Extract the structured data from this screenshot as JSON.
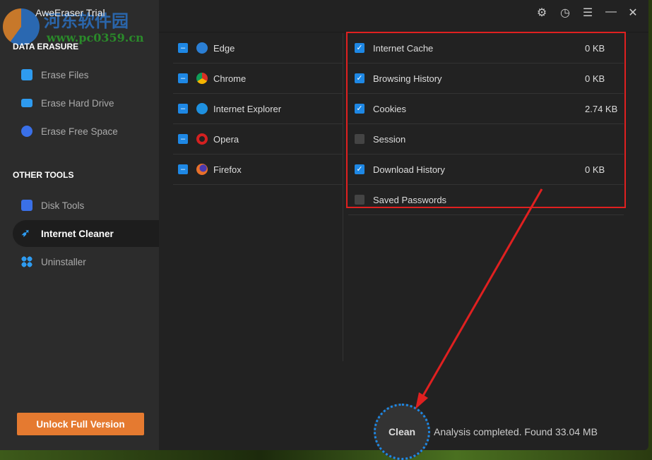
{
  "window": {
    "title": "AweEraser Trial"
  },
  "watermark": {
    "text": "河东软件园",
    "url": "www.pc0359.cn"
  },
  "sidebar": {
    "sections": [
      {
        "title": "DATA ERASURE"
      },
      {
        "title": "OTHER TOOLS"
      }
    ],
    "items": [
      {
        "label": "Erase Files",
        "icon": "folder-icon"
      },
      {
        "label": "Erase Hard Drive",
        "icon": "hard-drive-icon"
      },
      {
        "label": "Erase Free Space",
        "icon": "pie-chart-icon"
      },
      {
        "label": "Disk Tools",
        "icon": "toolbox-icon"
      },
      {
        "label": "Internet Cleaner",
        "icon": "rocket-icon",
        "active": true
      },
      {
        "label": "Uninstaller",
        "icon": "apps-icon"
      }
    ],
    "unlock_label": "Unlock Full Version"
  },
  "browsers": [
    {
      "name": "Edge",
      "color": "#2b7fd4"
    },
    {
      "name": "Chrome",
      "color": "#e8b020"
    },
    {
      "name": "Internet Explorer",
      "color": "#1e90e0"
    },
    {
      "name": "Opera",
      "color": "#d42020"
    },
    {
      "name": "Firefox",
      "color": "#e8702a"
    }
  ],
  "categories": [
    {
      "label": "Internet Cache",
      "checked": true,
      "size": "0 KB"
    },
    {
      "label": "Browsing History",
      "checked": true,
      "size": "0 KB"
    },
    {
      "label": "Cookies",
      "checked": true,
      "size": "2.74 KB"
    },
    {
      "label": "Session",
      "checked": false,
      "size": ""
    },
    {
      "label": "Download History",
      "checked": true,
      "size": "0 KB"
    },
    {
      "label": "Saved Passwords",
      "checked": false,
      "size": ""
    }
  ],
  "clean_label": "Clean",
  "status": "Analysis completed. Found 33.04 MB",
  "colors": {
    "accent": "#1e88e5",
    "unlock": "#e57a30",
    "annotation": "#e02020"
  }
}
